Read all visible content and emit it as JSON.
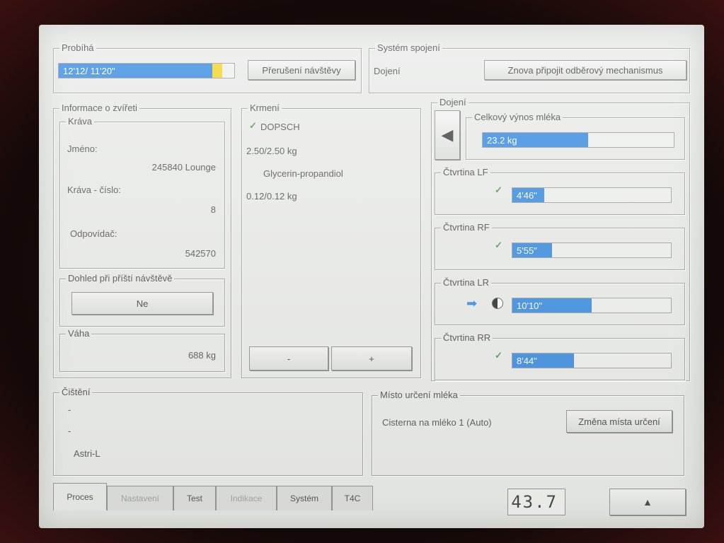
{
  "progress": {
    "legend": "Probíhá",
    "time": "12'12/ 11'20\"",
    "fraction": 0.93,
    "interrupt_label": "Přerušení návštěvy"
  },
  "connection": {
    "legend": "Systém spojení",
    "status": "Dojení",
    "reconnect_label": "Znova připojit odběrový mechanismus"
  },
  "animal": {
    "legend": "Informace o zvířeti",
    "cow_legend": "Kráva",
    "name_label": "Jméno:",
    "name_value": "245840 Lounge",
    "number_label": "Kráva - číslo:",
    "number_value": "8",
    "responder_label": "Odpovídač:",
    "responder_value": "542570",
    "supervision_legend": "Dohled při příští návštěvě",
    "supervision_value": "Ne",
    "weight_legend": "Váha",
    "weight_value": "688 kg"
  },
  "feeding": {
    "legend": "Krmení",
    "items": [
      {
        "name": "DOPSCH",
        "amount": "2.50/2.50 kg"
      },
      {
        "name": "Glycerin-propandiol",
        "amount": "0.12/0.12 kg"
      }
    ],
    "minus_label": "-",
    "plus_label": "+"
  },
  "milking": {
    "legend": "Dojení",
    "total_legend": "Celkový výnos mléka",
    "total_value": "23.2 kg",
    "total_fraction": 0.55,
    "quarters": [
      {
        "label": "Čtvrtina LF",
        "time": "4'46\"",
        "fraction": 0.2,
        "status": "done"
      },
      {
        "label": "Čtvrtina RF",
        "time": "5'55\"",
        "fraction": 0.25,
        "status": "done"
      },
      {
        "label": "Čtvrtina LR",
        "time": "10'10\"",
        "fraction": 0.5,
        "status": "active"
      },
      {
        "label": "Čtvrtina RR",
        "time": "8'44\"",
        "fraction": 0.39,
        "status": "done"
      }
    ]
  },
  "cleaning": {
    "legend": "Čištění",
    "line1": "-",
    "line2": "-",
    "line3": "Astri-L"
  },
  "destination": {
    "legend": "Místo určení mléka",
    "value": "Cisterna na mléko 1 (Auto)",
    "change_label": "Změna místa určení"
  },
  "tabs": [
    {
      "label": "Proces",
      "state": "active"
    },
    {
      "label": "Nastavení",
      "state": "disabled"
    },
    {
      "label": "Test",
      "state": "normal"
    },
    {
      "label": "Indikace",
      "state": "disabled"
    },
    {
      "label": "Systém",
      "state": "normal"
    },
    {
      "label": "T4C",
      "state": "normal"
    }
  ],
  "status_display": "43.7",
  "colors": {
    "bar": "#2f86e0",
    "progress_tail": "#f2d21e",
    "check": "#3d9a3d"
  }
}
